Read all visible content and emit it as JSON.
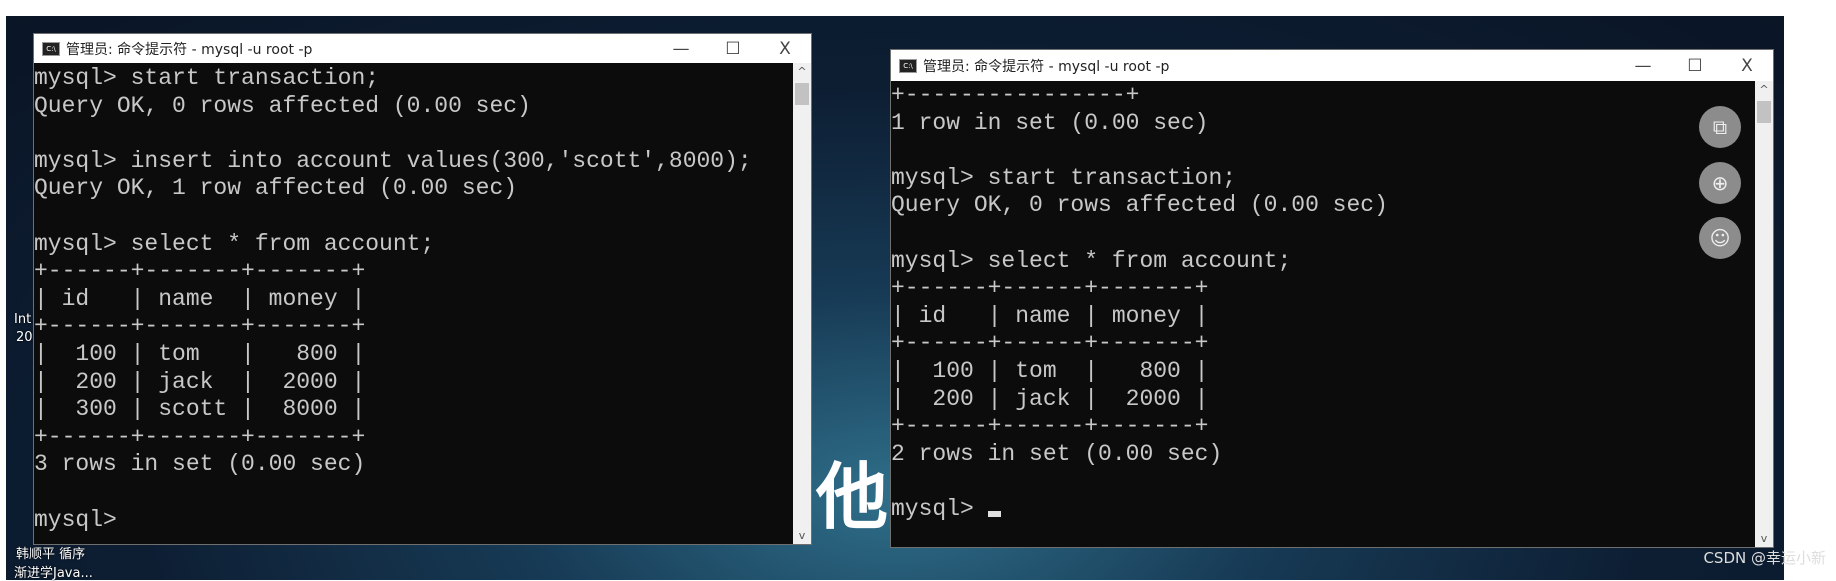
{
  "desktop": {
    "overlay_char": "他",
    "icon_labels": [
      "Int",
      "20",
      "韩顺平 循序",
      "渐进学Java..."
    ],
    "watermark": "CSDN @幸运小新"
  },
  "left_window": {
    "title": "管理员: 命令提示符 - mysql  -u root -p",
    "icon_text": "C:\\",
    "lines": [
      "mysql> start transaction;",
      "Query OK, 0 rows affected (0.00 sec)",
      "",
      "mysql> insert into account values(300,'scott',8000);",
      "Query OK, 1 row affected (0.00 sec)",
      "",
      "mysql> select * from account;",
      "+------+-------+-------+",
      "| id   | name  | money |",
      "+------+-------+-------+",
      "|  100 | tom   |   800 |",
      "|  200 | jack  |  2000 |",
      "|  300 | scott |  8000 |",
      "+------+-------+-------+",
      "3 rows in set (0.00 sec)",
      "",
      "mysql>"
    ]
  },
  "right_window": {
    "title": "管理员: 命令提示符 - mysql  -u root -p",
    "icon_text": "C:\\",
    "lines": [
      "+----------------+",
      "1 row in set (0.00 sec)",
      "",
      "mysql> start transaction;",
      "Query OK, 0 rows affected (0.00 sec)",
      "",
      "mysql> select * from account;",
      "+------+------+-------+",
      "| id   | name | money |",
      "+------+------+-------+",
      "|  100 | tom  |   800 |",
      "|  200 | jack |  2000 |",
      "+------+------+-------+",
      "2 rows in set (0.00 sec)",
      "",
      "mysql> "
    ],
    "floating_buttons": [
      "screen-share-icon",
      "copy-add-icon",
      "add-user-icon"
    ]
  },
  "controls": {
    "minimize": "—",
    "maximize": "☐",
    "close": "X",
    "scroll_up": "^",
    "scroll_down": "v"
  }
}
